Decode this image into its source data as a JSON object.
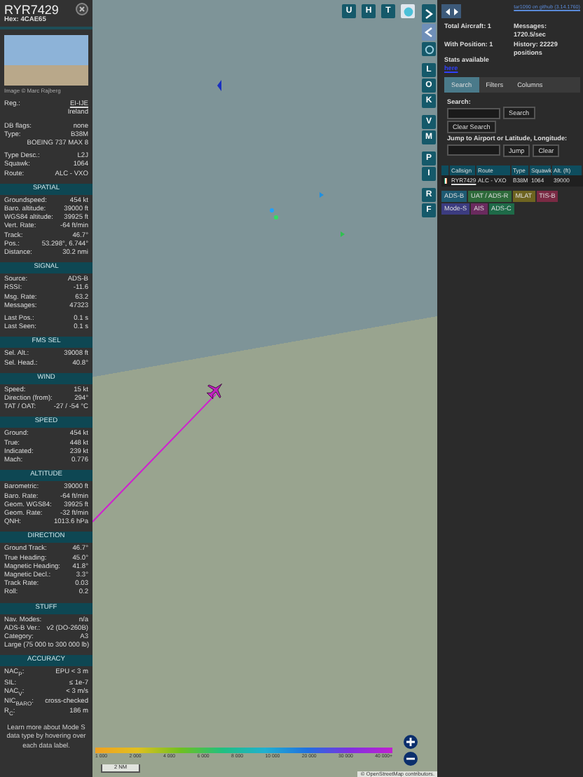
{
  "aircraft": {
    "callsign": "RYR7429",
    "hex_label": "Hex:",
    "hex": "4CAE65",
    "photo_credit": "Image © Marc Rajberg",
    "info_groups": [
      [
        {
          "label": "Reg.:",
          "value": "EI-IJE",
          "link": true
        },
        {
          "value": "Ireland"
        }
      ],
      [
        {
          "label": "DB flags:",
          "value": "none"
        },
        {
          "label": "Type:",
          "value": "B38M"
        },
        {
          "value": "BOEING 737 MAX 8"
        }
      ],
      [
        {
          "label": "Type Desc.:",
          "value": "L2J"
        },
        {
          "label": "Squawk:",
          "value": "1064"
        },
        {
          "label": "Route:",
          "value": "ALC - VXO"
        }
      ]
    ],
    "sections": [
      {
        "title": "SPATIAL",
        "groups": [
          [
            {
              "label": "Groundspeed:",
              "value": "454 kt"
            },
            {
              "label": "Baro. altitude:",
              "value": "39000 ft"
            },
            {
              "label": "WGS84 altitude:",
              "value": "39925 ft"
            },
            {
              "label": "Vert. Rate:",
              "value": "-64 ft/min"
            },
            {
              "label": "Track:",
              "value": "46.7°"
            },
            {
              "label": "Pos.:",
              "value": "53.298°, 6.744°"
            },
            {
              "label": "Distance:",
              "value": "30.2 nmi"
            }
          ]
        ]
      },
      {
        "title": "SIGNAL",
        "groups": [
          [
            {
              "label": "Source:",
              "value": "ADS-B"
            },
            {
              "label": "RSSI:",
              "value": "-11.6"
            },
            {
              "label": "Msg. Rate:",
              "value": "63.2"
            },
            {
              "label": "Messages:",
              "value": "47323"
            }
          ],
          [
            {
              "label": "Last Pos.:",
              "value": "0.1 s"
            },
            {
              "label": "Last Seen:",
              "value": "0.1 s"
            }
          ]
        ]
      },
      {
        "title": "FMS SEL",
        "groups": [
          [
            {
              "label": "Sel. Alt.:",
              "value": "39008 ft"
            },
            {
              "label": "Sel. Head.:",
              "value": "40.8°"
            }
          ]
        ]
      },
      {
        "title": "WIND",
        "groups": [
          [
            {
              "label": "Speed:",
              "value": "15 kt"
            },
            {
              "label": "Direction (from):",
              "value": "294°"
            },
            {
              "label": "TAT / OAT:",
              "value": "-27 / -54 °C"
            }
          ]
        ]
      },
      {
        "title": "SPEED",
        "groups": [
          [
            {
              "label": "Ground:",
              "value": "454 kt"
            },
            {
              "label": "True:",
              "value": "448 kt"
            },
            {
              "label": "Indicated:",
              "value": "239 kt"
            },
            {
              "label": "Mach:",
              "value": "0.776"
            }
          ]
        ]
      },
      {
        "title": "ALTITUDE",
        "groups": [
          [
            {
              "label": "Barometric:",
              "value": "39000 ft"
            },
            {
              "label": "Baro. Rate:",
              "value": "-64 ft/min"
            },
            {
              "label": "Geom. WGS84:",
              "value": "39925 ft"
            },
            {
              "label": "Geom. Rate:",
              "value": "-32 ft/min"
            },
            {
              "label": "QNH:",
              "value": "1013.6 hPa"
            }
          ]
        ]
      },
      {
        "title": "DIRECTION",
        "groups": [
          [
            {
              "label": "Ground Track:",
              "value": "46.7°"
            },
            {
              "label": "True Heading:",
              "value": "45.0°"
            },
            {
              "label": "Magnetic Heading:",
              "value": "41.8°"
            },
            {
              "label": "Magnetic Decl.:",
              "value": "3.3°"
            },
            {
              "label": "Track Rate:",
              "value": "0.03"
            },
            {
              "label": "Roll:",
              "value": "0.2"
            }
          ]
        ]
      },
      {
        "title": "STUFF",
        "groups": [
          [
            {
              "label": "Nav. Modes:",
              "value": "n/a"
            },
            {
              "label": "ADS-B Ver.:",
              "value": "v2 (DO-260B)"
            },
            {
              "label": "Category:",
              "value": "A3"
            },
            {
              "label": "Large (75 000 to 300 000 lb)"
            }
          ]
        ]
      },
      {
        "title": "ACCURACY",
        "groups": [
          [
            {
              "label": "NAC$_{P}$:",
              "value": "EPU < 3 m"
            },
            {
              "label": "SIL:",
              "value": "≤ 1e-7"
            },
            {
              "label": "NAC$_{V}$:",
              "value": "< 3 m/s"
            },
            {
              "label": "NIC$_{BARO}$:",
              "value": "cross-checked"
            },
            {
              "label": "R$_{C}$:",
              "value": "186 m"
            }
          ]
        ]
      }
    ],
    "footer": "Learn more about Mode S data type by hovering over each data label."
  },
  "map": {
    "top_buttons": [
      "U",
      "H",
      "T"
    ],
    "side_groups": [
      [
        "L",
        "O",
        "K"
      ],
      [
        "V",
        "M"
      ],
      [
        "P",
        "I"
      ],
      [
        "R",
        "F"
      ]
    ],
    "scale": "2 NM",
    "attribution": "© OpenStreetMap contributors.",
    "altitude_legend": [
      "1 000",
      "2 000",
      "4 000",
      "6 000",
      "8 000",
      "10 000",
      "20 000",
      "30 000",
      "40 000+"
    ]
  },
  "sidebar": {
    "version_link": "tar1090 on github (3.14.1760)",
    "stats": [
      {
        "label": "Total Aircraft: 1"
      },
      {
        "label": "Messages:",
        "value": "1720.5/sec"
      },
      {
        "label": "With Position: 1"
      },
      {
        "label": "History: 22229",
        "value": "positions"
      }
    ],
    "stats_note": "Stats available",
    "stats_link": "here",
    "tabs": [
      {
        "label": "Search",
        "selected": true
      },
      {
        "label": "Filters",
        "selected": false
      },
      {
        "label": "Columns",
        "selected": false
      }
    ],
    "search_label": "Search:",
    "search_button": "Search",
    "clear_search_button": "Clear Search",
    "jump_label": "Jump to Airport or Latitude, Longitude:",
    "jump_button": "Jump",
    "clear_button": "Clear",
    "table": {
      "columns": [
        "Callsign",
        "Route",
        "Type",
        "Squawk",
        "Alt. (ft)"
      ],
      "rows": [
        {
          "cells": [
            "RYR7429",
            "ALC - VXO",
            "B38M",
            "1064",
            "39000"
          ]
        }
      ]
    },
    "legend": [
      {
        "label": "ADS-B",
        "color": "#1e5a72"
      },
      {
        "label": "UAT / ADS-R",
        "color": "#2e6a3a"
      },
      {
        "label": "MLAT",
        "color": "#6e6420"
      },
      {
        "label": "TIS-B",
        "color": "#7a2a44"
      },
      {
        "label": "Mode-S",
        "color": "#3c3c80"
      },
      {
        "label": "AIS",
        "color": "#6a2a5e"
      },
      {
        "label": "ADS-C",
        "color": "#1e6a48"
      }
    ]
  }
}
